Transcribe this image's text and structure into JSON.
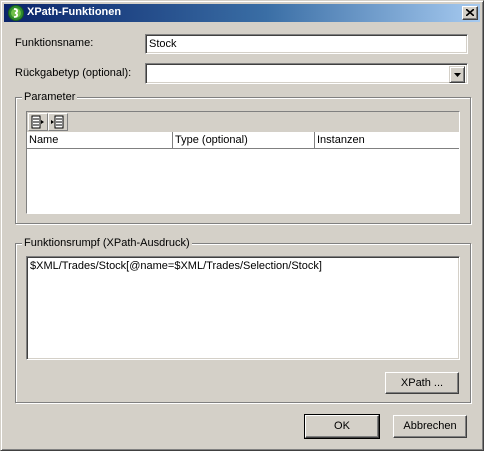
{
  "window": {
    "title": "XPath-Funktionen",
    "close_glyph": "×"
  },
  "form": {
    "function_name_label": "Funktionsname:",
    "function_name_value": "Stock",
    "return_type_label": "Rückgabetyp (optional):",
    "return_type_value": ""
  },
  "parameters": {
    "group_title": "Parameter",
    "toolbar_icons": [
      "append-row-icon",
      "insert-row-icon"
    ],
    "columns": [
      "Name",
      "Type (optional)",
      "Instanzen"
    ],
    "rows": []
  },
  "body": {
    "group_title": "Funktionsrumpf (XPath-Ausdruck)",
    "expression": "$XML/Trades/Stock[@name=$XML/Trades/Selection/Stock]",
    "xpath_button": "XPath ..."
  },
  "footer": {
    "ok_button": "OK",
    "cancel_button": "Abbrechen"
  },
  "colors": {
    "title_active_start": "#0a246a",
    "title_active_end": "#a6caf0",
    "face": "#d4d0c8"
  }
}
